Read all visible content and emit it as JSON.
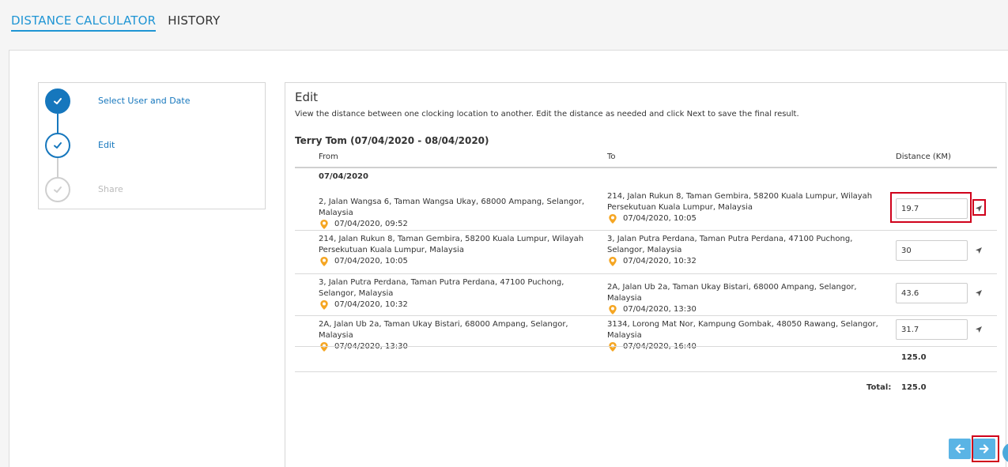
{
  "tabs": {
    "calculator": "DISTANCE CALCULATOR",
    "history": "HISTORY"
  },
  "steps": {
    "step1": "Select User and Date",
    "step2": "Edit",
    "step3": "Share"
  },
  "card": {
    "title": "Edit",
    "description": "View the distance between one clocking location to another. Edit the distance as needed and click Next to save the final result.",
    "user_range": "Terry Tom (07/04/2020 - 08/04/2020)"
  },
  "columns": {
    "from": "From",
    "to": "To",
    "distance": "Distance (KM)"
  },
  "group_date": "07/04/2020",
  "rows": [
    {
      "from_address": "2, Jalan Wangsa 6, Taman Wangsa Ukay, 68000 Ampang, Selangor, Malaysia",
      "from_time": "07/04/2020, 09:52",
      "to_address": "214, Jalan Rukun 8, Taman Gembira, 58200 Kuala Lumpur, Wilayah Persekutuan Kuala Lumpur, Malaysia",
      "to_time": "07/04/2020, 10:05",
      "distance": "19.7"
    },
    {
      "from_address": "214, Jalan Rukun 8, Taman Gembira, 58200 Kuala Lumpur, Wilayah Persekutuan Kuala Lumpur, Malaysia",
      "from_time": "07/04/2020, 10:05",
      "to_address": "3, Jalan Putra Perdana, Taman Putra Perdana, 47100 Puchong, Selangor, Malaysia",
      "to_time": "07/04/2020, 10:32",
      "distance": "30"
    },
    {
      "from_address": "3, Jalan Putra Perdana, Taman Putra Perdana, 47100 Puchong, Selangor, Malaysia",
      "from_time": "07/04/2020, 10:32",
      "to_address": "2A, Jalan Ub 2a, Taman Ukay Bistari, 68000 Ampang, Selangor, Malaysia",
      "to_time": "07/04/2020, 13:30",
      "distance": "43.6"
    },
    {
      "from_address": "2A, Jalan Ub 2a, Taman Ukay Bistari, 68000 Ampang, Selangor, Malaysia",
      "from_time": "07/04/2020, 13:30",
      "to_address": "3134, Lorong Mat Nor, Kampung Gombak, 48050 Rawang, Selangor, Malaysia",
      "to_time": "07/04/2020, 16:40",
      "distance": "31.7"
    }
  ],
  "subtotal": "125.0",
  "total": {
    "label": "Total:",
    "value": "125.0"
  },
  "icons": {
    "location": "map-pin-icon",
    "navigate": "navigation-arrow-icon",
    "back": "arrow-left-icon",
    "next": "arrow-right-icon",
    "check": "check-icon"
  },
  "colors": {
    "accent": "#1f95d4",
    "step_blue": "#1677bd",
    "pin_orange": "#f5a623",
    "highlight_red": "#d0021b",
    "button_blue": "#5ab4e5"
  }
}
